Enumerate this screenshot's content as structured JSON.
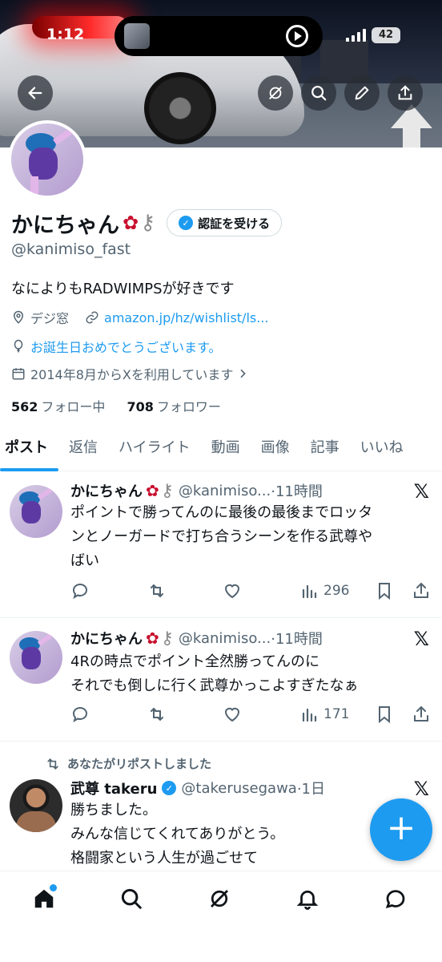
{
  "status_bar": {
    "time": "1:12",
    "battery": "42"
  },
  "profile": {
    "name": "かにちゃん",
    "name_emojis": [
      "rose",
      "key"
    ],
    "verify_label": "認証を受ける",
    "handle": "@kanimiso_fast",
    "bio": "なによりもRADWIMPSが好きです",
    "location": "デジ窓",
    "link": "amazon.jp/hz/wishlist/ls...",
    "birthday": "お誕生日おめでとうございます。",
    "joined": "2014年8月からXを利用しています",
    "following_count": "562",
    "following_label": "フォロー中",
    "followers_count": "708",
    "followers_label": "フォロワー"
  },
  "tabs": [
    {
      "label": "ポスト",
      "active": true
    },
    {
      "label": "返信"
    },
    {
      "label": "ハイライト"
    },
    {
      "label": "動画"
    },
    {
      "label": "画像"
    },
    {
      "label": "記事"
    },
    {
      "label": "いいね"
    }
  ],
  "posts": [
    {
      "author": "かにちゃん",
      "handle": "@kanimiso...",
      "time": "·11時間",
      "lines": [
        "ポイントで勝ってんのに最後の最後までロッタ",
        "ンとノーガードで打ち合うシーンを作る武尊や",
        "ばい"
      ],
      "views": "296"
    },
    {
      "author": "かにちゃん",
      "handle": "@kanimiso...",
      "time": "·11時間",
      "lines": [
        "4Rの時点でポイント全然勝ってんのに",
        "それでも倒しに行く武尊かっこよすぎたなぁ"
      ],
      "views": "171"
    },
    {
      "repost_label": "あなたがリポストしました",
      "author": "武尊 takeru",
      "handle": "@takerusegawa",
      "time": "·1日",
      "lines": [
        "勝ちました。",
        "みんな信じてくれてありがとう。",
        "格闘家という人生が過ごせて"
      ]
    }
  ],
  "colors": {
    "accent": "#1d9bf0",
    "text": "#0f1419",
    "muted": "#536471"
  }
}
